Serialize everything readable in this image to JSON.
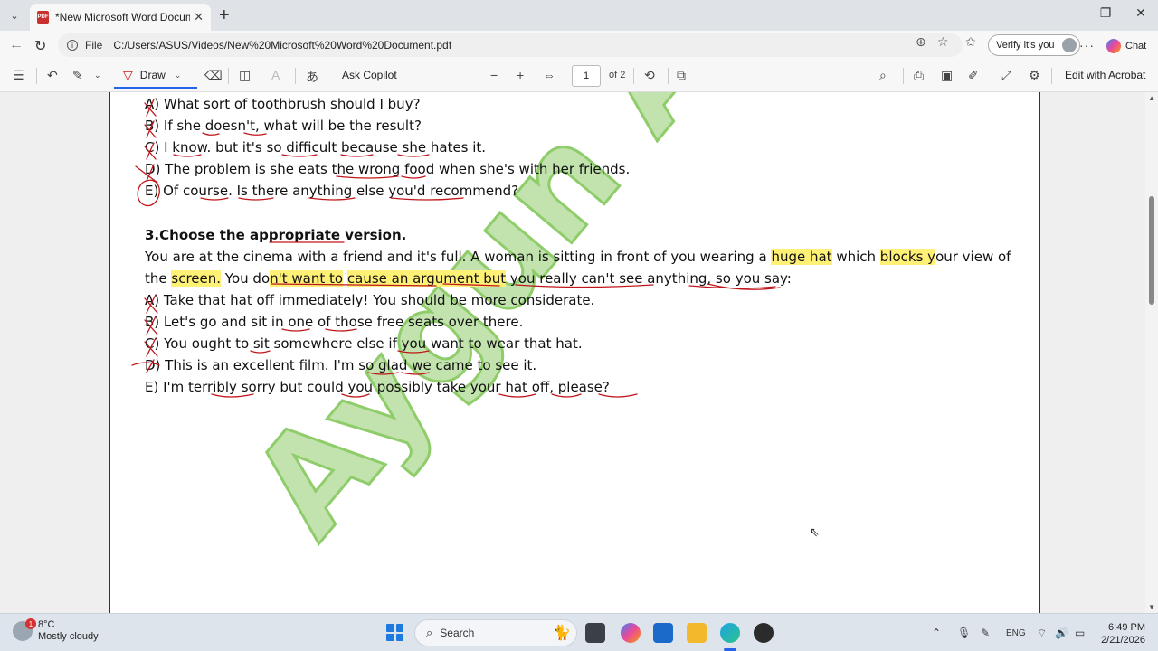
{
  "browser": {
    "tab_title": "*New Microsoft Word Document.pdf",
    "tab_close": "✕",
    "new_tab": "+",
    "window_controls": {
      "minimize": "—",
      "maximize": "❐",
      "close": "✕"
    },
    "file_label": "File",
    "url": "C:/Users/ASUS/Videos/New%20Microsoft%20Word%20Document.pdf",
    "verify_label": "Verify it's you",
    "more_label": "···",
    "chat_label": "Chat"
  },
  "pdf_toolbar": {
    "draw_label": "Draw",
    "ask_copilot_label": "Ask Copilot",
    "page_current": "1",
    "page_total_label": "of 2",
    "edit_acrobat_label": "Edit with Acrobat"
  },
  "document": {
    "q2_options": [
      "A) What sort of toothbrush should I buy?",
      "B) If she doesn't, what will be the result?",
      "C) I know. but it's so difficult because she hates it.",
      "D) The problem is she eats the wrong food when she's with her friends.",
      "E) Of course. Is there anything else you'd recommend?"
    ],
    "q3_heading": "3.Choose the appropriate version.",
    "q3_prompt_line1_a": "You are at the cinema with a friend and it's full. A woman is sitting in front of you wearing a ",
    "q3_prompt_hl1": "huge hat",
    "q3_prompt_line1_b": " which ",
    "q3_prompt_hl2": "blocks y",
    "q3_prompt_line1_c": "our view of",
    "q3_prompt_line2_a": "the ",
    "q3_prompt_hl3": "screen.",
    "q3_prompt_line2_b": " You do",
    "q3_prompt_hl4": "n't want to",
    "q3_prompt_line2_c": " ",
    "q3_prompt_hl5": "cause an argument but",
    "q3_prompt_line2_d": " you really can't see anything, so you say:",
    "q3_options": [
      "A) Take that hat off immediately! You should be more considerate.",
      "B) Let's go and sit in one of those free seats over there.",
      "C) You ought to sit somewhere else if you want to wear that hat.",
      "D) This is an excellent film. I'm so glad we came to see it.",
      "E) I'm terribly sorry but could you possibly take your hat off, please?"
    ],
    "watermark_text": "Aygun Ahmadova",
    "watermark_color": "#8fcc6a",
    "ink_color": "#c0161b",
    "highlight_color": "#fff176"
  },
  "taskbar": {
    "weather_badge": "1",
    "weather_temp": "8°C",
    "weather_desc": "Mostly cloudy",
    "search_label": "Search",
    "language": "ENG",
    "time": "6:49 PM",
    "date": "2/21/2026"
  }
}
